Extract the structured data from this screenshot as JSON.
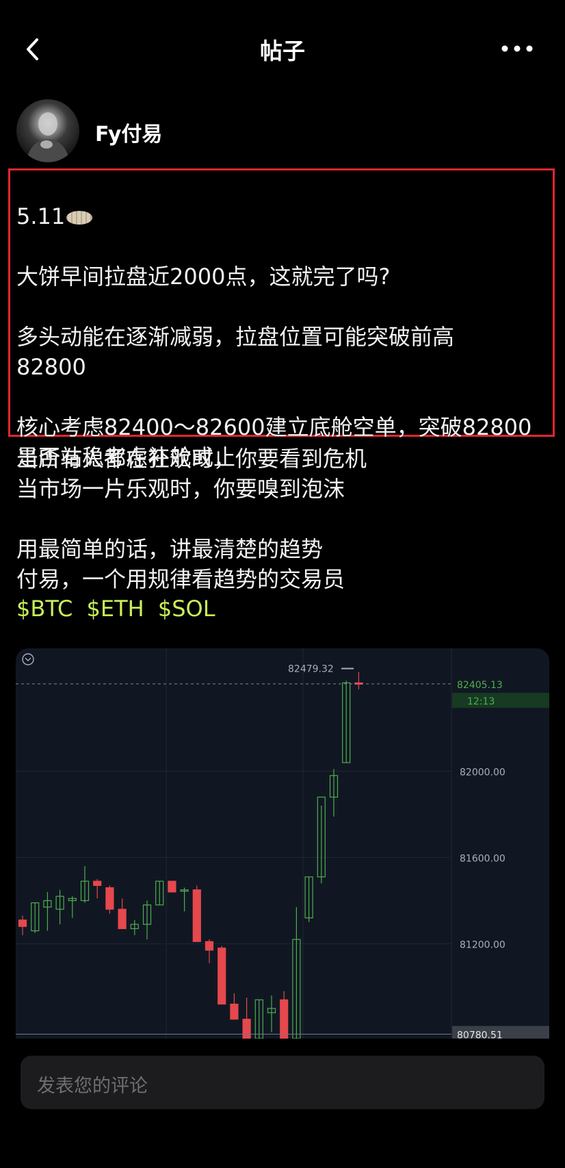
{
  "header": {
    "title": "帖子",
    "back_icon": "chevron-left-icon",
    "more_icon": "more-horizontal-icon"
  },
  "author": {
    "name": "Fy付易"
  },
  "post": {
    "date": "5.11",
    "highlight_block": "大饼早间拉盘近2000点，这就完了吗?\n\n多头动能在逐渐减弱，拉盘位置可能突破前高\n82800\n\n核心考虑82400～82600建立底舱空单，突破82800\n是否站稳考虑补舱或止",
    "body_block": "当所有人都在狂欢时，你要看到危机\n当市场一片乐观时，你要嗅到泡沫\n\n用最简单的话，讲最清楚的趋势\n付易，一个用规律看趋势的交易员",
    "tags": [
      "$BTC",
      "$ETH",
      "$SOL"
    ]
  },
  "chart_data": {
    "type": "candlestick",
    "y_ticks": [
      "82000.00",
      "81600.00",
      "81200.00"
    ],
    "current_price_label": "82405.13",
    "countdown_label": "12:13",
    "high_label": "82479.32",
    "low_marker_label": "80780.51",
    "ylim": [
      80760,
      82570
    ],
    "up_color": "#4caf50",
    "down_color": "#e5484d",
    "candles": [
      {
        "o": 81310,
        "h": 81330,
        "l": 81240,
        "c": 81280
      },
      {
        "o": 81260,
        "h": 81390,
        "l": 81250,
        "c": 81390
      },
      {
        "o": 81370,
        "h": 81440,
        "l": 81260,
        "c": 81400
      },
      {
        "o": 81360,
        "h": 81450,
        "l": 81290,
        "c": 81420
      },
      {
        "o": 81400,
        "h": 81420,
        "l": 81320,
        "c": 81410
      },
      {
        "o": 81400,
        "h": 81560,
        "l": 81390,
        "c": 81490
      },
      {
        "o": 81490,
        "h": 81500,
        "l": 81410,
        "c": 81470
      },
      {
        "o": 81460,
        "h": 81470,
        "l": 81340,
        "c": 81360
      },
      {
        "o": 81360,
        "h": 81410,
        "l": 81270,
        "c": 81270
      },
      {
        "o": 81270,
        "h": 81310,
        "l": 81240,
        "c": 81290
      },
      {
        "o": 81290,
        "h": 81400,
        "l": 81220,
        "c": 81380
      },
      {
        "o": 81380,
        "h": 81490,
        "l": 81380,
        "c": 81490
      },
      {
        "o": 81490,
        "h": 81490,
        "l": 81440,
        "c": 81440
      },
      {
        "o": 81450,
        "h": 81460,
        "l": 81350,
        "c": 81450
      },
      {
        "o": 81450,
        "h": 81470,
        "l": 81210,
        "c": 81210
      },
      {
        "o": 81210,
        "h": 81220,
        "l": 81110,
        "c": 81170
      },
      {
        "o": 81180,
        "h": 81190,
        "l": 80920,
        "c": 80920
      },
      {
        "o": 80920,
        "h": 80970,
        "l": 80850,
        "c": 80850
      },
      {
        "o": 80850,
        "h": 80950,
        "l": 80760,
        "c": 80760
      },
      {
        "o": 80760,
        "h": 80940,
        "l": 80760,
        "c": 80940
      },
      {
        "o": 80880,
        "h": 80960,
        "l": 80790,
        "c": 80900
      },
      {
        "o": 80940,
        "h": 80980,
        "l": 80760,
        "c": 80760
      },
      {
        "o": 80760,
        "h": 81370,
        "l": 80760,
        "c": 81220
      },
      {
        "o": 81320,
        "h": 81510,
        "l": 81300,
        "c": 81510
      },
      {
        "o": 81510,
        "h": 81840,
        "l": 81480,
        "c": 81880
      },
      {
        "o": 81880,
        "h": 82010,
        "l": 81790,
        "c": 81980
      },
      {
        "o": 82040,
        "h": 82420,
        "l": 82040,
        "c": 82410
      },
      {
        "o": 82410,
        "h": 82460,
        "l": 82380,
        "c": 82405
      }
    ]
  },
  "comment": {
    "placeholder": "发表您的评论"
  }
}
